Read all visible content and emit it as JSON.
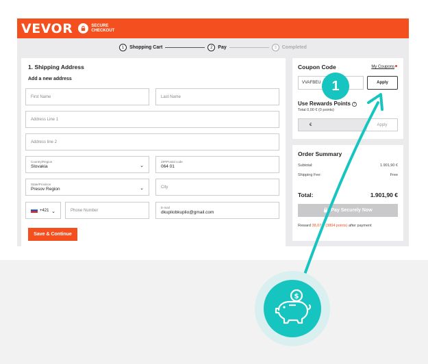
{
  "header": {
    "logo": "VEVOR",
    "secure_line1": "SECURE",
    "secure_line2": "CHECKOUT"
  },
  "steps": [
    {
      "num": "1",
      "label": "Shopping Cart"
    },
    {
      "num": "2",
      "label": "Pay"
    },
    {
      "num": "3",
      "label": "Completed"
    }
  ],
  "shipping": {
    "title": "1. Shipping Address",
    "subtitle": "Add a new address",
    "first_name_placeholder": "First Name",
    "last_name_placeholder": "Last Name",
    "address1_placeholder": "Address Line 1",
    "address2_placeholder": "Address line 2",
    "country_label": "Country/Region",
    "country_value": "Slovakia",
    "zip_label": "ZIP/Postal code",
    "zip_value": "064 01",
    "state_label": "State/Province",
    "state_value": "Presov Region",
    "city_placeholder": "City",
    "phone_code": "+421",
    "phone_placeholder": "Phone Number",
    "email_label": "E-mail",
    "email_value": "dkupliobkuplio@gmail.com",
    "save_label": "Save & Continue"
  },
  "coupon": {
    "title": "Coupon Code",
    "my_coupons": "My Coupons",
    "code_value": "VVAFBEU",
    "apply_label": "Apply",
    "rewards_title": "Use Rewards Points",
    "rewards_total": "Total 0,00 € (0 points)",
    "rewards_currency": "€",
    "rewards_apply": "Apply"
  },
  "summary": {
    "title": "Order Summary",
    "subtotal_label": "Subtotal:",
    "subtotal_value": "1.901,90 €",
    "shipping_label": "Shipping Fee:",
    "shipping_value": "Free",
    "total_label": "Total:",
    "total_value": "1.901,90 €",
    "pay_label": "Pay Securely Now",
    "reward_prefix": "Reward",
    "reward_highlight": "38,07 € (3804 points)",
    "reward_suffix": "after payment"
  },
  "annotation": {
    "badge": "1",
    "coin_symbol": "$"
  },
  "colors": {
    "brand": "#f44f1e",
    "annotation": "#16c4c0",
    "annotation_halo": "#d9eff0"
  }
}
